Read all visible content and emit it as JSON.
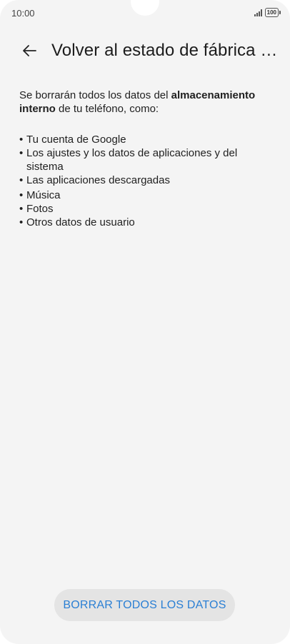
{
  "status_bar": {
    "time": "10:00",
    "battery": "100"
  },
  "header": {
    "title": "Volver al estado de fábrica (...",
    "back_icon": "arrow-left-icon"
  },
  "main": {
    "intro_prefix": "Se borrarán todos los datos del ",
    "intro_bold": "almacenamiento interno",
    "intro_suffix": " de tu teléfono, como:",
    "items": [
      "Tu cuenta de Google",
      "Los ajustes y los datos de aplicaciones y del sistema",
      "Las aplicaciones descargadas",
      "Música",
      "Fotos",
      "Otros datos de usuario"
    ]
  },
  "footer": {
    "button_label": "BORRAR TODOS LOS DATOS"
  },
  "colors": {
    "background": "#f4f4f4",
    "accent": "#2a7fd4",
    "button_bg": "#e4e4e4"
  }
}
